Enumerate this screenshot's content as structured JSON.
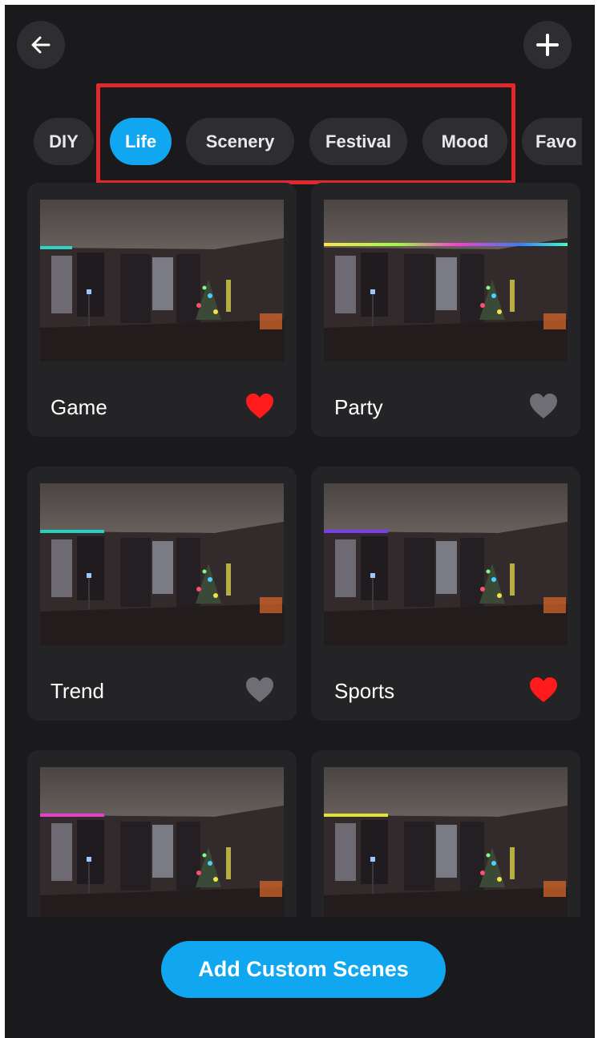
{
  "header": {
    "back_icon": "arrow-left-icon",
    "add_icon": "plus-icon"
  },
  "tabs": [
    {
      "label": "DIY",
      "active": false
    },
    {
      "label": "Life",
      "active": true
    },
    {
      "label": "Scenery",
      "active": false
    },
    {
      "label": "Festival",
      "active": false
    },
    {
      "label": "Mood",
      "active": false
    },
    {
      "label": "Favo",
      "active": false
    }
  ],
  "scenes": [
    {
      "name": "Game",
      "favorite": true,
      "strip_color": "#2fd3c8"
    },
    {
      "name": "Party",
      "favorite": false,
      "strip_color": "rainbow"
    },
    {
      "name": "Trend",
      "favorite": false,
      "strip_color": "#22d3c4"
    },
    {
      "name": "Sports",
      "favorite": true,
      "strip_color": "#7b3cf0"
    },
    {
      "name": "",
      "favorite": false,
      "strip_color": "#e93fd0"
    },
    {
      "name": "",
      "favorite": false,
      "strip_color": "#e6e233"
    }
  ],
  "footer": {
    "add_label": "Add Custom Scenes"
  },
  "colors": {
    "accent": "#11a7f0",
    "favorite": "#ff1b1b",
    "unfavorite": "#6e6e74",
    "background": "#1a1a1c",
    "highlight": "#e0282e"
  }
}
